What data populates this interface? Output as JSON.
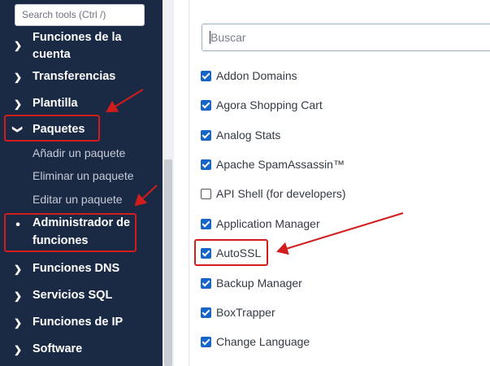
{
  "sidebar": {
    "search_placeholder": "Search tools (Ctrl /)",
    "items": [
      {
        "label_line1": "Funciones de la",
        "label_line2": "cuenta",
        "icon": "chevron-right-icon"
      },
      {
        "label": "Transferencias",
        "icon": "chevron-right-icon"
      },
      {
        "label": "Plantilla",
        "icon": "chevron-right-icon"
      },
      {
        "label": "Paquetes",
        "icon": "chevron-down-icon"
      },
      {
        "label": "Añadir un paquete"
      },
      {
        "label": "Eliminar un paquete"
      },
      {
        "label": "Editar un paquete"
      },
      {
        "label_line1": "Administrador de",
        "label_line2": "funciones",
        "icon": "bullet-icon"
      },
      {
        "label": "Funciones DNS",
        "icon": "chevron-right-icon"
      },
      {
        "label": "Servicios SQL",
        "icon": "chevron-right-icon"
      },
      {
        "label": "Funciones de IP",
        "icon": "chevron-right-icon"
      },
      {
        "label": "Software",
        "icon": "chevron-right-icon"
      }
    ]
  },
  "main": {
    "search_placeholder": "Buscar",
    "features": [
      {
        "label": "Addon Domains",
        "checked": true
      },
      {
        "label": "Agora Shopping Cart",
        "checked": true
      },
      {
        "label": "Analog Stats",
        "checked": true
      },
      {
        "label": "Apache SpamAssassin™",
        "checked": true
      },
      {
        "label": "API Shell (for developers)",
        "checked": false
      },
      {
        "label": "Application Manager",
        "checked": true
      },
      {
        "label": "AutoSSL",
        "checked": true
      },
      {
        "label": "Backup Manager",
        "checked": true
      },
      {
        "label": "BoxTrapper",
        "checked": true
      },
      {
        "label": "Change Language",
        "checked": true
      }
    ]
  },
  "colors": {
    "sidebar_bg": "#1b2a44",
    "checkbox_accent": "#1766c7",
    "highlight_red": "#d31c1c"
  }
}
